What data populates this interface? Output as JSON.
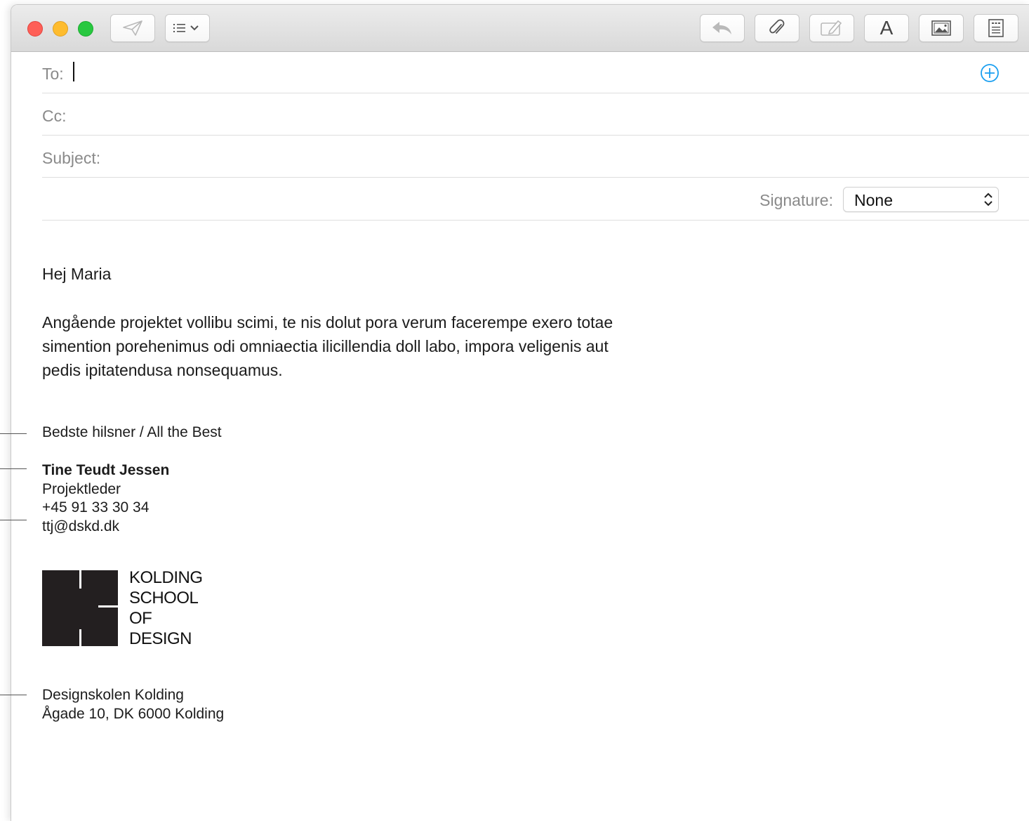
{
  "window": {
    "controls": [
      "close",
      "minimize",
      "maximize"
    ]
  },
  "toolbar": {
    "left_buttons": [
      {
        "name": "send",
        "icon": "paper-plane-icon",
        "enabled": false
      },
      {
        "name": "format-list",
        "icon": "list-chevron-icon",
        "enabled": true
      }
    ],
    "right_buttons": [
      {
        "name": "reply",
        "icon": "reply-arrow-icon",
        "enabled": false
      },
      {
        "name": "attach",
        "icon": "paperclip-icon",
        "enabled": true
      },
      {
        "name": "markup",
        "icon": "markup-icon",
        "enabled": false
      },
      {
        "name": "fonts",
        "icon": "font-a-icon",
        "label": "A",
        "enabled": true
      },
      {
        "name": "photo-browser",
        "icon": "photo-icon",
        "enabled": true
      },
      {
        "name": "stationery",
        "icon": "template-icon",
        "enabled": true
      }
    ]
  },
  "header": {
    "to_label": "To:",
    "to_value": "",
    "cc_label": "Cc:",
    "cc_value": "",
    "subject_label": "Subject:",
    "subject_value": "",
    "signature_label": "Signature:",
    "signature_value": "None"
  },
  "message": {
    "greeting": "Hej Maria",
    "paragraph": "Angående projektet vollibu scimi, te nis dolut pora verum facerempe exero totae simention porehenimus odi omniaectia ilicillendia doll labo, impora veligenis aut pedis ipitatendusa nonsequamus."
  },
  "signature": {
    "closing": "Bedste hilsner / All the Best",
    "name": "Tine Teudt Jessen",
    "title": "Projektleder",
    "phone": "+45 91 33 30 34",
    "email": "ttj@dskd.dk",
    "logo_lines": [
      "KOLDING",
      "SCHOOL",
      "OF",
      "DESIGN"
    ],
    "org_name": "Designskolen Kolding",
    "address": "Ågade 10, DK 6000 Kolding"
  },
  "colors": {
    "accent": "#1a9ff0",
    "close": "#fe5f57",
    "minimize": "#febc2e",
    "maximize": "#28c840",
    "logo": "#231f20"
  }
}
